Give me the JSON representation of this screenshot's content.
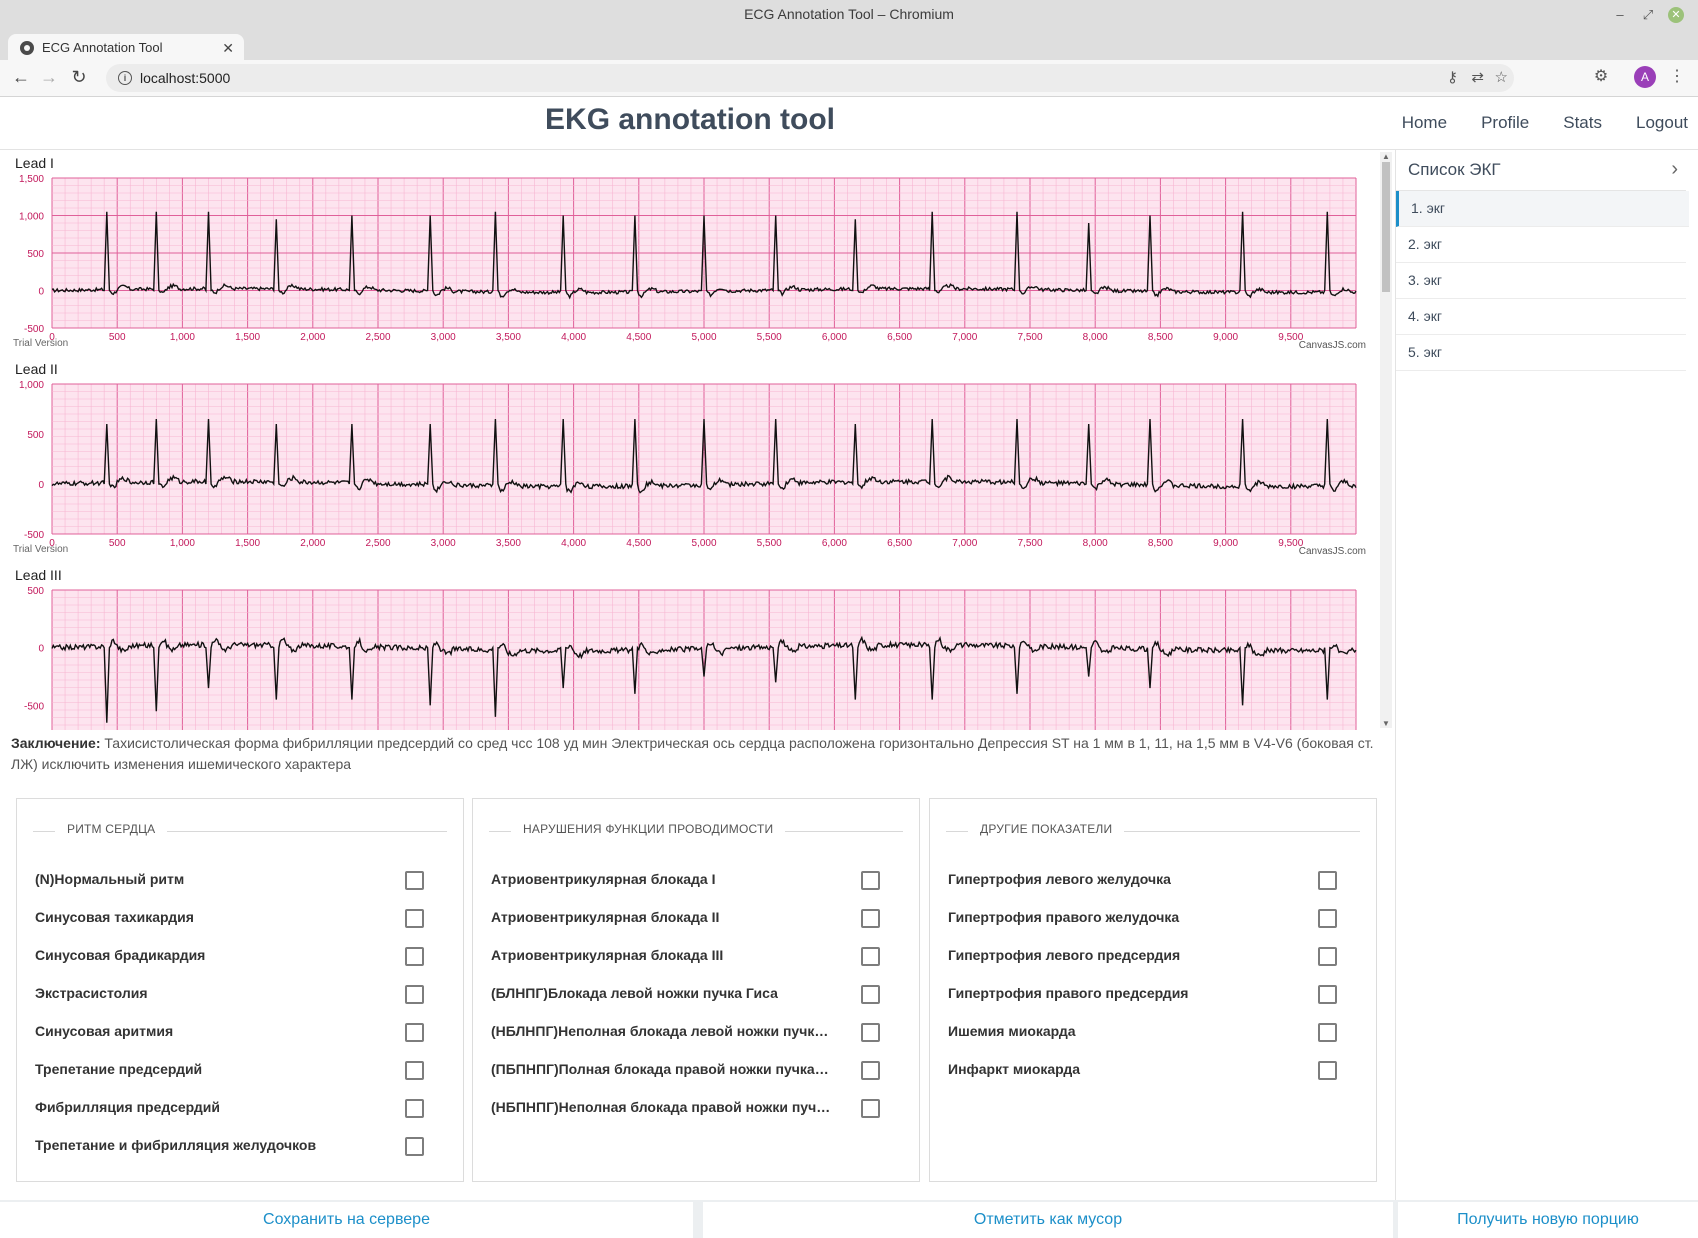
{
  "window": {
    "title": "ECG Annotation Tool – Chromium"
  },
  "tab": {
    "title": "ECG Annotation Tool"
  },
  "address": {
    "url": "localhost:5000"
  },
  "profile": {
    "initial": "A"
  },
  "app": {
    "title": "EKG annotation tool",
    "nav": [
      "Home",
      "Profile",
      "Stats",
      "Logout"
    ]
  },
  "charts": [
    {
      "lead": "Lead I",
      "ylim": [
        -500,
        1500
      ],
      "yticks": [
        "1,500",
        "1,000",
        "500",
        "0",
        "-500"
      ],
      "polarity": 1,
      "trial": "Trial Version",
      "credit": "CanvasJS.com"
    },
    {
      "lead": "Lead II",
      "ylim": [
        -500,
        1000
      ],
      "yticks": [
        "1,000",
        "500",
        "0",
        "-500"
      ],
      "polarity": 1,
      "trial": "Trial Version",
      "credit": "CanvasJS.com"
    },
    {
      "lead": "Lead III",
      "ylim": [
        -800,
        500
      ],
      "yticks": [
        "500",
        "0",
        "-500"
      ],
      "polarity": -1,
      "trial": "",
      "credit": ""
    }
  ],
  "chart_data": [
    {
      "type": "line",
      "title": "Lead I",
      "xlim": [
        0,
        10000
      ],
      "ylim": [
        -500,
        1500
      ],
      "xticks": [
        "0",
        "500",
        "1,000",
        "1,500",
        "2,000",
        "2,500",
        "3,000",
        "3,500",
        "4,000",
        "4,500",
        "5,000",
        "5,500",
        "6,000",
        "6,500",
        "7,000",
        "7,500",
        "8,000",
        "8,500",
        "9,000",
        "9,500"
      ],
      "peaks_x": [
        420,
        800,
        1200,
        1720,
        2300,
        2900,
        3400,
        3920,
        4470,
        5000,
        5550,
        6160,
        6750,
        7400,
        7950,
        8420,
        9130,
        9780
      ],
      "peak_values": [
        1050,
        1050,
        1050,
        950,
        1000,
        1000,
        1050,
        1000,
        1000,
        1000,
        1000,
        950,
        1050,
        1050,
        900,
        1000,
        1050,
        1050
      ]
    },
    {
      "type": "line",
      "title": "Lead II",
      "xlim": [
        0,
        10000
      ],
      "ylim": [
        -500,
        1000
      ],
      "xticks": [
        "0",
        "500",
        "1,000",
        "1,500",
        "2,000",
        "2,500",
        "3,000",
        "3,500",
        "4,000",
        "4,500",
        "5,000",
        "5,500",
        "6,000",
        "6,500",
        "7,000",
        "7,500",
        "8,000",
        "8,500",
        "9,000",
        "9,500"
      ],
      "peaks_x": [
        420,
        800,
        1200,
        1720,
        2300,
        2900,
        3400,
        3920,
        4470,
        5000,
        5550,
        6160,
        6750,
        7400,
        7950,
        8420,
        9130,
        9780
      ],
      "peak_values": [
        600,
        650,
        650,
        600,
        600,
        600,
        650,
        650,
        650,
        650,
        650,
        600,
        650,
        650,
        600,
        650,
        650,
        650
      ]
    },
    {
      "type": "line",
      "title": "Lead III",
      "xlim": [
        0,
        10000
      ],
      "ylim": [
        -800,
        500
      ],
      "peaks_x": [
        420,
        800,
        1200,
        1720,
        2300,
        2900,
        3400,
        3920,
        4470,
        5000,
        5550,
        6160,
        6750,
        7400,
        7950,
        8420,
        9130,
        9780
      ],
      "peak_values": [
        -650,
        -550,
        -350,
        -450,
        -450,
        -500,
        -600,
        -350,
        -400,
        -250,
        -300,
        -450,
        -450,
        -400,
        -250,
        -350,
        -500,
        -450
      ]
    }
  ],
  "conclusion": {
    "label": "Заключение:",
    "text": "Тахисистолическая форма фибрилляции предсердий со сред чсс 108 уд мин Электрическая ось сердца расположена горизонтально Депрессия ST на 1 мм в 1, 11, на 1,5 мм в V4-V6 (боковая ст. ЛЖ) исключить изменения ишемического характера"
  },
  "groups": [
    {
      "title": "РИТМ СЕРДЦА",
      "items": [
        "(N)Нормальный ритм",
        "Синусовая тахикардия",
        "Синусовая брадикардия",
        "Экстрасистолия",
        "Синусовая аритмия",
        "Трепетание предсердий",
        "Фибрилляция предсердий",
        "Трепетание и фибрилляция желудочков"
      ]
    },
    {
      "title": "НАРУШЕНИЯ ФУНКЦИИ ПРОВОДИМОСТИ",
      "items": [
        "Атриовентрикулярная блокада I",
        "Атриовентрикулярная блокада II",
        "Атриовентрикулярная блокада III",
        "(БЛНПГ)Блокада левой ножки пучка Гиса",
        "(НБЛНПГ)Неполная блокада левой ножки пучка...",
        "(ПБПНПГ)Полная блокада правой ножки пучка Г...",
        "(НБПНПГ)Неполная блокада правой ножки пучк..."
      ]
    },
    {
      "title": "ДРУГИЕ ПОКАЗАТЕЛИ",
      "items": [
        "Гипертрофия левого желудочка",
        "Гипертрофия правого желудочка",
        "Гипертрофия левого предсердия",
        "Гипертрофия правого предсердия",
        "Ишемия миокарда",
        "Инфаркт миокарда"
      ]
    }
  ],
  "sidebar": {
    "title": "Список ЭКГ",
    "items": [
      "1. экг",
      "2. экг",
      "3. экг",
      "4. экг",
      "5. экг"
    ]
  },
  "footer": {
    "save": "Сохранить на сервере",
    "trash": "Отметить как мусор",
    "next": "Получить новую порцию"
  },
  "colors": {
    "accent": "#1c8fc9",
    "grid_major": "#e0609a",
    "grid_minor": "#f7b6d2",
    "grid_bg": "#fde4ef",
    "trace": "#111111"
  }
}
